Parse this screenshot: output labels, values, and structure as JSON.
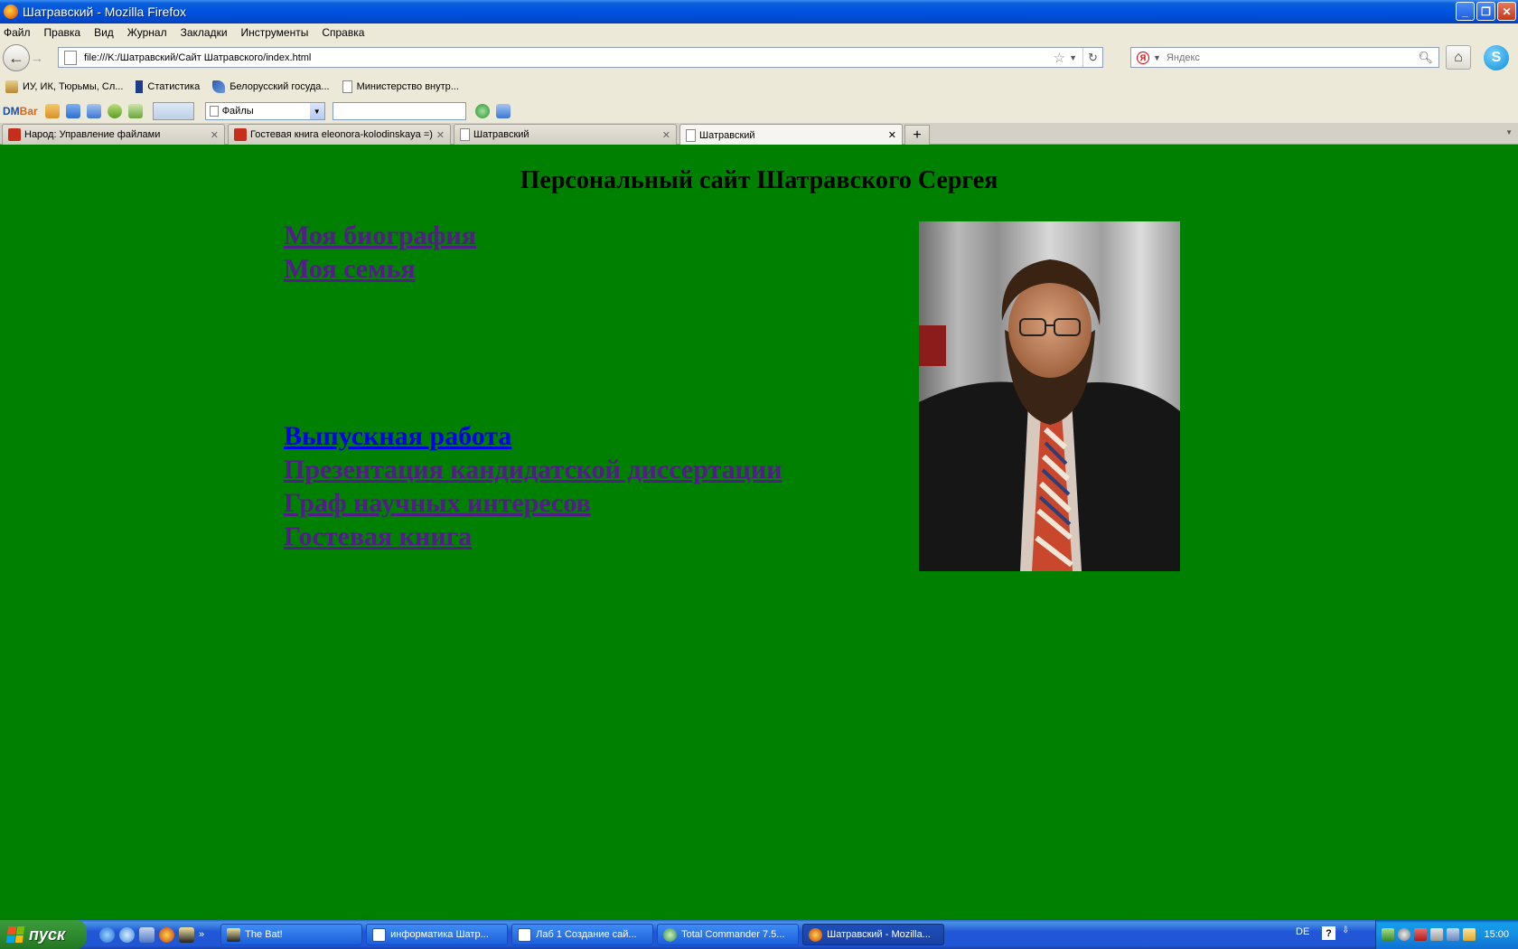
{
  "window": {
    "title": "Шатравский - Mozilla Firefox"
  },
  "menu": {
    "items": [
      "Файл",
      "Правка",
      "Вид",
      "Журнал",
      "Закладки",
      "Инструменты",
      "Справка"
    ]
  },
  "nav": {
    "url": "file:///K:/Шатравский/Сайт Шатравского/index.html",
    "search_placeholder": "Яндекс",
    "search_engine_letter": "Я"
  },
  "bookmarks": {
    "items": [
      "ИУ, ИК, Тюрьмы, Сл...",
      "Статистика",
      "Белорусский госуда...",
      "Министерство внутр..."
    ]
  },
  "dmbar": {
    "logo_a": "DM",
    "logo_b": "Bar",
    "select_value": "Файлы"
  },
  "tabs": [
    {
      "label": "Народ: Управление файлами",
      "icon": "narod-icon"
    },
    {
      "label": "Гостевая книга eleonora-kolodinskaya =)",
      "icon": "narod-icon"
    },
    {
      "label": "Шатравский",
      "icon": "page-icon"
    },
    {
      "label": "Шатравский",
      "icon": "page-icon"
    }
  ],
  "page": {
    "heading": "Персональный сайт Шатравского Сергея",
    "links_top": [
      "Моя биография",
      "Моя семья"
    ],
    "links_bottom": [
      "Выпускная работа",
      "Презентация кандидатской диссертации",
      "Граф научных интересов",
      "Гостевая книга"
    ],
    "background_color": "#008000",
    "visited_link_color": "#551A8B",
    "unvisited_link_color": "#0000EE"
  },
  "taskbar": {
    "start_label": "пуск",
    "tasks": [
      "The Bat!",
      "информатика Шатр...",
      "Лаб 1 Создание сай...",
      "Total Commander 7.5...",
      "Шатравский - Mozilla..."
    ],
    "language": "DE",
    "help": "?",
    "clock": "15:00"
  }
}
